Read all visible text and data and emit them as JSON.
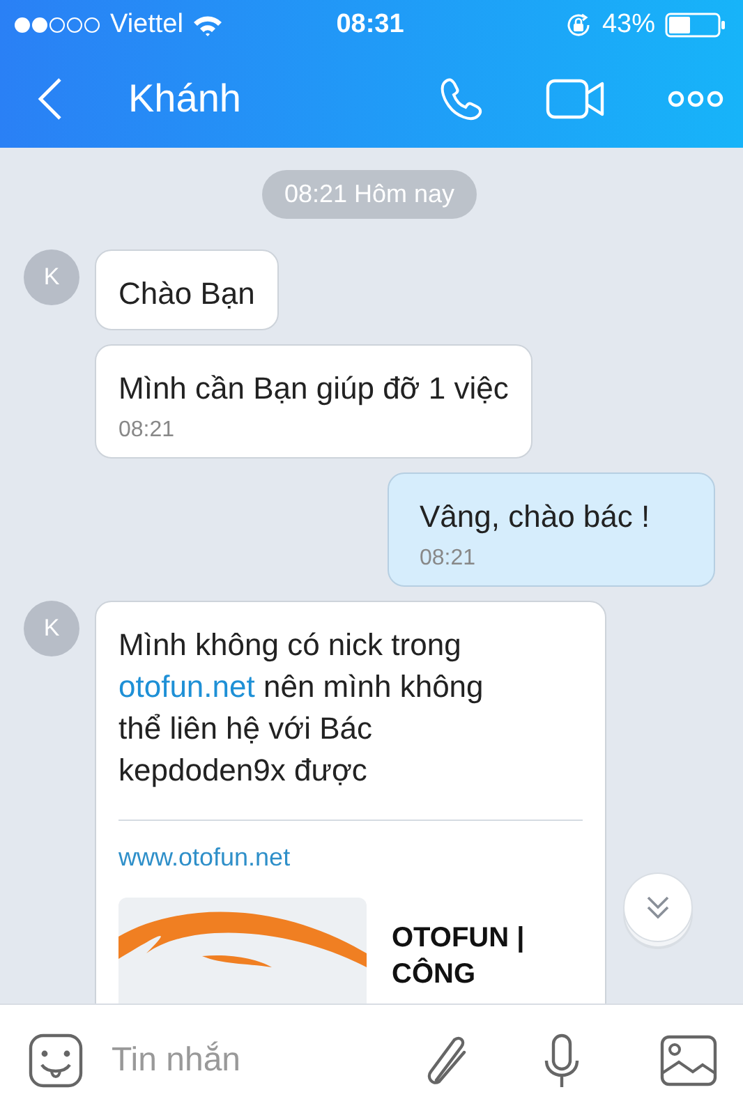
{
  "status_bar": {
    "carrier": "Viettel",
    "time": "08:31",
    "battery": "43%"
  },
  "header": {
    "title": "Khánh"
  },
  "messages": [
    {
      "kind": "timestamp",
      "text": "08:21 Hôm nay"
    },
    {
      "kind": "incoming",
      "avatar": "K",
      "text": "Chào Bạn"
    },
    {
      "kind": "incoming",
      "text": "Mình cần Bạn giúp đỡ 1 việc",
      "time": "08:21"
    },
    {
      "kind": "outgoing",
      "text": "Vâng, chào bác !",
      "time": "08:21"
    },
    {
      "kind": "incoming_link",
      "avatar": "K",
      "parts": [
        {
          "kind": "text",
          "text": "Mình không có nick trong "
        },
        {
          "kind": "link",
          "text": "otofun.net"
        },
        {
          "kind": "text",
          "text": " nên mình không thể liên hệ với Bác kepdoden9x được"
        }
      ],
      "preview": {
        "url": "www.otofun.net",
        "title": "OTOFUN | CÔNG"
      }
    }
  ],
  "composer": {
    "placeholder": "Tin nhắn"
  }
}
